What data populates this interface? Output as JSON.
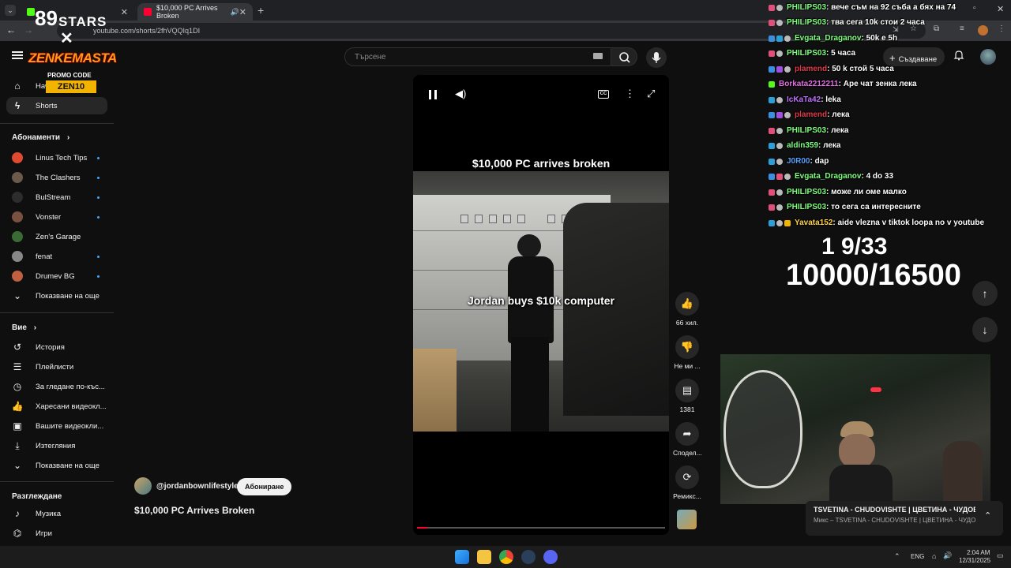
{
  "browser": {
    "tabs": [
      {
        "title": "",
        "active": false
      },
      {
        "title": "$10,000 PC Arrives Broken",
        "active": true
      }
    ],
    "url": "youtube.com/shorts/2fhVQQIq1DI"
  },
  "header": {
    "search_placeholder": "Търсене",
    "create_label": "Създаване"
  },
  "sidebar": {
    "main": [
      {
        "label": "Нач",
        "icon": "home-icon"
      },
      {
        "label": "Shorts",
        "icon": "shorts-icon"
      }
    ],
    "subs_title": "Абонаменти",
    "subs": [
      {
        "label": "Linus Tech Tips",
        "color": "#e04a2f"
      },
      {
        "label": "The Clashers",
        "color": "#6b5a4a"
      },
      {
        "label": "BulStream",
        "color": "#2d2d2d"
      },
      {
        "label": "Vonster",
        "color": "#7a5040"
      },
      {
        "label": "Zen's Garage",
        "color": "#3a6b35"
      },
      {
        "label": "fenat",
        "color": "#888888"
      },
      {
        "label": "Drumev BG",
        "color": "#c06040"
      }
    ],
    "show_more": "Показване на още",
    "you_title": "Вие",
    "you": [
      {
        "label": "История",
        "icon": "history-icon"
      },
      {
        "label": "Плейлисти",
        "icon": "playlist-icon"
      },
      {
        "label": "За гледане по-къс...",
        "icon": "clock-icon"
      },
      {
        "label": "Харесани видеокл...",
        "icon": "like-icon"
      },
      {
        "label": "Вашите видеокли...",
        "icon": "video-icon"
      },
      {
        "label": "Изтегляния",
        "icon": "download-icon"
      },
      {
        "label": "Показване на още",
        "icon": "chevron-down-icon"
      }
    ],
    "explore_title": "Разглеждане",
    "explore": [
      {
        "label": "Музика",
        "icon": "music-icon"
      },
      {
        "label": "Игри",
        "icon": "games-icon"
      }
    ]
  },
  "short": {
    "title_top": "$10,000 PC arrives broken",
    "caption": "Jordan buys $10k computer",
    "channel": "@jordanbownlifestyle",
    "subscribe": "Абониране",
    "video_title": "$10,000 PC Arrives Broken",
    "actions": {
      "likes": "66 хил.",
      "dislike": "Не ми ...",
      "comments": "1381",
      "share": "Сподел...",
      "remix": "Ремикс..."
    }
  },
  "overlay": {
    "logo_top": "STARS",
    "logo_name": "ZENKEMASTA",
    "promo_label": "PROMO CODE",
    "promo_code": "ZEN10",
    "counter_1": "1 9/33",
    "counter_2": "10000/16500",
    "now_playing_title": "TSVETINA - CHUDOVISHTE | ЦВЕТИНА - ЧУДОВ...",
    "now_playing_sub": "Микс – TSVETINA - CHUDOVISHTE | ЦВЕТИНА - ЧУДОВ...",
    "chat": [
      {
        "user": "PHILIPS03",
        "msg": ": вече съм на 92 съба а бях на 74",
        "color": "#7fff7f"
      },
      {
        "user": "PHILIPS03",
        "msg": ": тва сега 10k стои 2 часа",
        "color": "#7fff7f"
      },
      {
        "user": "Evgata_Draganov",
        "msg": ": 50k е 5h",
        "color": "#7fff7f"
      },
      {
        "user": "PHILIPS03",
        "msg": ": 5 часа",
        "color": "#7fff7f"
      },
      {
        "user": "plamend",
        "msg": ": 50 k стой 5 часа",
        "color": "#e03a4a"
      },
      {
        "user": "Borkata2212211",
        "msg": ": Аре чат зенка лека",
        "color": "#e070e0"
      },
      {
        "user": "IcKaTa42",
        "msg": ": leka",
        "color": "#c070ff"
      },
      {
        "user": "plamend",
        "msg": ": лека",
        "color": "#e03a4a"
      },
      {
        "user": "PHILIPS03",
        "msg": ": лека",
        "color": "#7fff7f"
      },
      {
        "user": "aldin359",
        "msg": ": лека",
        "color": "#7fff7f"
      },
      {
        "user": "J0R00",
        "msg": ": dap",
        "color": "#5aa0ff"
      },
      {
        "user": "Evgata_Draganov",
        "msg": ": 4 do 33",
        "color": "#7fff7f"
      },
      {
        "user": "PHILIPS03",
        "msg": ": може ли оме малко",
        "color": "#7fff7f"
      },
      {
        "user": "PHILIPS03",
        "msg": ": то сега са интересните",
        "color": "#7fff7f"
      },
      {
        "user": "Yavata152",
        "msg": ": aide vlezna v tiktok loopa no v youtube",
        "color": "#ffd24a"
      }
    ]
  },
  "taskbar": {
    "lang": "ENG",
    "time": "2:04 AM",
    "date": "12/31/2025"
  }
}
